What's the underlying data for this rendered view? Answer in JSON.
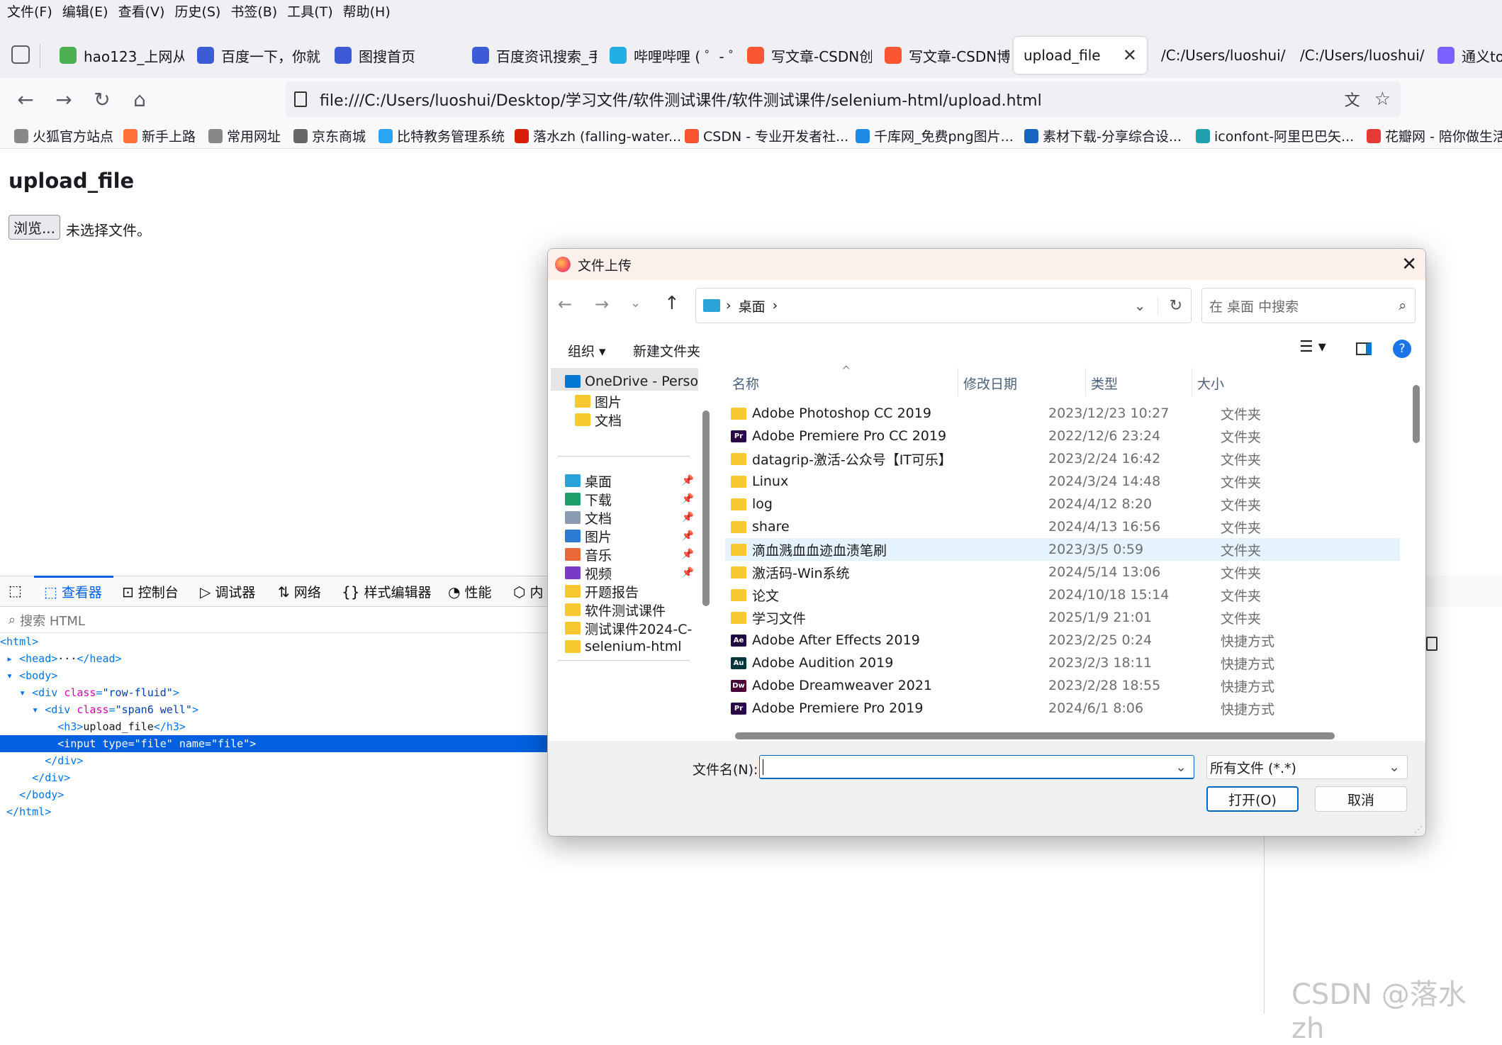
{
  "menubar": [
    "文件(F)",
    "编辑(E)",
    "查看(V)",
    "历史(S)",
    "书签(B)",
    "工具(T)",
    "帮助(H)"
  ],
  "tabs": [
    {
      "label": "hao123_上网从",
      "color": "#4caf50"
    },
    {
      "label": "百度一下，你就",
      "color": "#3b5cd6"
    },
    {
      "label": "图搜首页",
      "color": "#3b5cd6"
    },
    {
      "label": "百度资讯搜索_手",
      "color": "#3b5cd6"
    },
    {
      "label": "哔哩哔哩 ( ゜- ゜",
      "color": "#23ade5"
    },
    {
      "label": "写文章-CSDN创",
      "color": "#fc5531"
    },
    {
      "label": "写文章-CSDN博",
      "color": "#fc5531"
    },
    {
      "label": "upload_file",
      "color": ""
    },
    {
      "label": "/C:/Users/luoshui/",
      "color": ""
    },
    {
      "label": "/C:/Users/luoshui/",
      "color": ""
    },
    {
      "label": "通义ton",
      "color": "#7b61ff"
    }
  ],
  "url": "file:///C:/Users/luoshui/Desktop/学习文件/软件测试课件/软件测试课件/selenium-html/upload.html",
  "bookmarks": [
    {
      "label": "火狐官方站点",
      "color": "#888888"
    },
    {
      "label": "新手上路",
      "color": "#ff7139"
    },
    {
      "label": "常用网址",
      "color": "#888888"
    },
    {
      "label": "京东商城",
      "color": "#666666"
    },
    {
      "label": "比特教务管理系统",
      "color": "#2aa4f4"
    },
    {
      "label": "落水zh (falling-water...",
      "color": "#d81e06"
    },
    {
      "label": "CSDN - 专业开发者社...",
      "color": "#fc5531"
    },
    {
      "label": "千库网_免费png图片...",
      "color": "#1e88e5"
    },
    {
      "label": "素材下载-分享综合设...",
      "color": "#1565c0"
    },
    {
      "label": "iconfont-阿里巴巴矢...",
      "color": "#21a0b0"
    },
    {
      "label": "花瓣网 - 陪你做生活",
      "color": "#e53935"
    }
  ],
  "page": {
    "heading": "upload_file",
    "browse": "浏览...",
    "no_file": "未选择文件。"
  },
  "devtools": {
    "tabs": [
      "查看器",
      "控制台",
      "调试器",
      "网络",
      "样式编辑器",
      "性能",
      "内"
    ],
    "search_placeholder": "搜索 HTML",
    "dom": [
      {
        "pre": "",
        "parts": [
          [
            "tag",
            "<html>"
          ]
        ]
      },
      {
        "pre": " ▸ ",
        "parts": [
          [
            "tag",
            "<head>"
          ],
          [
            "txt",
            "···"
          ],
          [
            "tag",
            "</head>"
          ]
        ]
      },
      {
        "pre": " ▾ ",
        "parts": [
          [
            "tag",
            "<body>"
          ]
        ]
      },
      {
        "pre": "   ▾ ",
        "parts": [
          [
            "tag",
            "<div "
          ],
          [
            "attr",
            "class"
          ],
          [
            "tag",
            "="
          ],
          [
            "val",
            "\"row-fluid\""
          ],
          [
            "tag",
            ">"
          ]
        ]
      },
      {
        "pre": "     ▾ ",
        "parts": [
          [
            "tag",
            "<div "
          ],
          [
            "attr",
            "class"
          ],
          [
            "tag",
            "="
          ],
          [
            "val",
            "\"span6 well\""
          ],
          [
            "tag",
            ">"
          ]
        ]
      },
      {
        "pre": "         ",
        "parts": [
          [
            "tag",
            "<h3>"
          ],
          [
            "txt",
            "upload_file"
          ],
          [
            "tag",
            "</h3>"
          ]
        ]
      },
      {
        "pre": "         ",
        "parts": [
          [
            "tag",
            "<input "
          ],
          [
            "attr",
            "type"
          ],
          [
            "tag",
            "="
          ],
          [
            "val",
            "\"file\""
          ],
          [
            "tag",
            " "
          ],
          [
            "attr",
            "name"
          ],
          [
            "tag",
            "="
          ],
          [
            "val",
            "\"file\""
          ],
          [
            "tag",
            ">"
          ]
        ],
        "selected": true
      },
      {
        "pre": "       ",
        "parts": [
          [
            "tag",
            "</div>"
          ]
        ]
      },
      {
        "pre": "     ",
        "parts": [
          [
            "tag",
            "</div>"
          ]
        ]
      },
      {
        "pre": "   ",
        "parts": [
          [
            "tag",
            "</body>"
          ]
        ]
      },
      {
        "pre": " ",
        "parts": [
          [
            "tag",
            "</html>"
          ]
        ]
      }
    ]
  },
  "dialog": {
    "title": "文件上传",
    "location": "桌面",
    "search_placeholder": "在 桌面 中搜索",
    "organize": "组织 ▾",
    "new_folder": "新建文件夹",
    "sidebar": [
      {
        "label": "OneDrive - Perso",
        "color": "#0078d4",
        "pin": false
      },
      {
        "label": "图片",
        "color": "#f8c830",
        "pin": false
      },
      {
        "label": "文档",
        "color": "#f8c830",
        "pin": false
      },
      {
        "label": "桌面",
        "color": "#2aa4d8",
        "pin": true
      },
      {
        "label": "下载",
        "color": "#1e9e6a",
        "pin": true
      },
      {
        "label": "文档",
        "color": "#8a9ab0",
        "pin": true
      },
      {
        "label": "图片",
        "color": "#2b7cd3",
        "pin": true
      },
      {
        "label": "音乐",
        "color": "#e86a3a",
        "pin": true
      },
      {
        "label": "视频",
        "color": "#7a3ac8",
        "pin": true
      },
      {
        "label": "开题报告",
        "color": "#f8c830",
        "pin": false
      },
      {
        "label": "软件测试课件",
        "color": "#f8c830",
        "pin": false
      },
      {
        "label": "测试课件2024-C-",
        "color": "#f8c830",
        "pin": false
      },
      {
        "label": "selenium-html",
        "color": "#f8c830",
        "pin": false
      }
    ],
    "columns": {
      "name": "名称",
      "date": "修改日期",
      "type": "类型",
      "size": "大小"
    },
    "files": [
      {
        "name": "Adobe Photoshop CC 2019",
        "date": "2023/12/23 10:27",
        "type": "文件夹",
        "icon": "folder"
      },
      {
        "name": "Adobe Premiere Pro CC 2019",
        "date": "2022/12/6 23:24",
        "type": "文件夹",
        "icon": "pr"
      },
      {
        "name": "datagrip-激活-公众号【IT可乐】",
        "date": "2023/2/24 16:42",
        "type": "文件夹",
        "icon": "folder"
      },
      {
        "name": "Linux",
        "date": "2024/3/24 14:48",
        "type": "文件夹",
        "icon": "folder"
      },
      {
        "name": "log",
        "date": "2024/4/12 8:20",
        "type": "文件夹",
        "icon": "folder"
      },
      {
        "name": "share",
        "date": "2024/4/13 16:56",
        "type": "文件夹",
        "icon": "folder"
      },
      {
        "name": "滴血溅血血迹血渍笔刷",
        "date": "2023/3/5 0:59",
        "type": "文件夹",
        "icon": "folder",
        "hover": true
      },
      {
        "name": "激活码-Win系统",
        "date": "2024/5/14 13:06",
        "type": "文件夹",
        "icon": "folder"
      },
      {
        "name": "论文",
        "date": "2024/10/18 15:14",
        "type": "文件夹",
        "icon": "folder"
      },
      {
        "name": "学习文件",
        "date": "2025/1/9 21:01",
        "type": "文件夹",
        "icon": "folder"
      },
      {
        "name": "Adobe After Effects 2019",
        "date": "2023/2/25 0:24",
        "type": "快捷方式",
        "icon": "ae"
      },
      {
        "name": "Adobe Audition 2019",
        "date": "2023/2/3 18:11",
        "type": "快捷方式",
        "icon": "au"
      },
      {
        "name": "Adobe Dreamweaver 2021",
        "date": "2023/2/28 18:55",
        "type": "快捷方式",
        "icon": "dw"
      },
      {
        "name": "Adobe Premiere Pro 2019",
        "date": "2024/6/1 8:06",
        "type": "快捷方式",
        "icon": "pr"
      }
    ],
    "filename_label": "文件名(N):",
    "filename_value": "",
    "filter": "所有文件 (*.*)",
    "open": "打开(O)",
    "cancel": "取消"
  },
  "watermark": "CSDN @落水 zh",
  "colors": {
    "accent": "#0061e0",
    "dialog_title_bg": "#fbf1ea",
    "selection": "#0060df"
  }
}
